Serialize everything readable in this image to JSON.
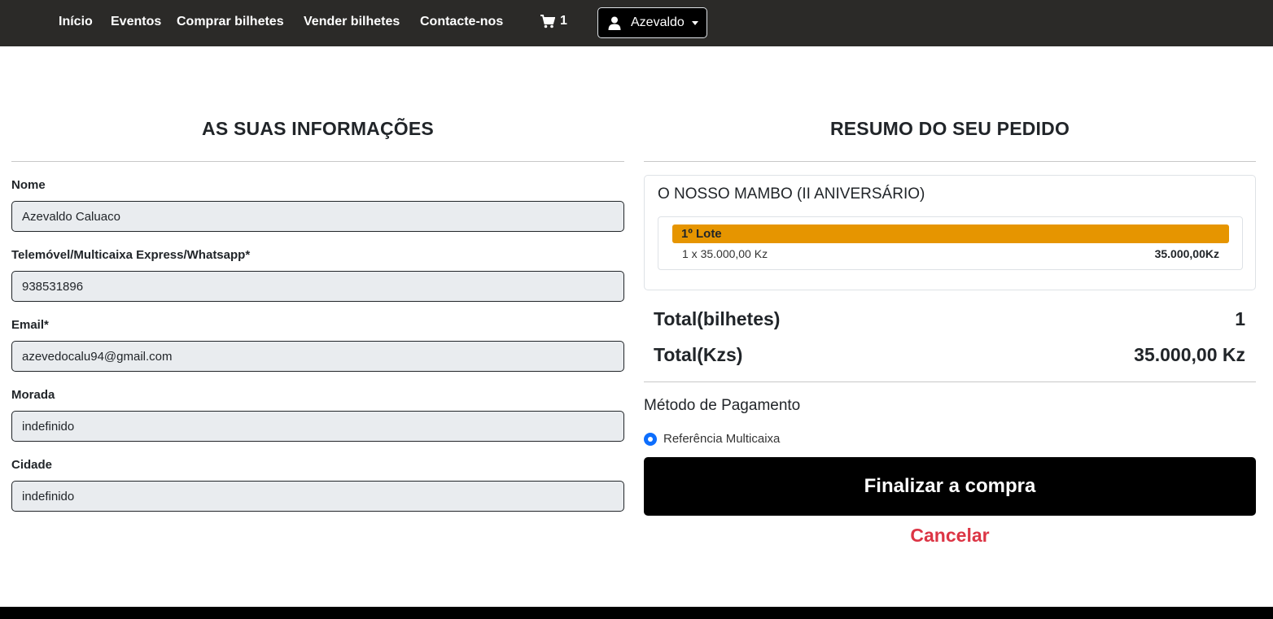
{
  "navbar": {
    "links": [
      "Início",
      "Eventos",
      "Comprar bilhetes",
      "Vender bilhetes",
      "Contacte-nos"
    ],
    "cart_icon": "shopping-cart-icon",
    "cart_count": "1",
    "user_icon": "user-icon",
    "user_name": "Azevaldo"
  },
  "info_section": {
    "title": "AS SUAS INFORMAÇÕES",
    "fields": [
      {
        "label": "Nome",
        "value": "Azevaldo Caluaco"
      },
      {
        "label": "Telemóvel/Multicaixa Express/Whatsapp*",
        "value": "938531896"
      },
      {
        "label": "Email*",
        "value": "azevedocalu94@gmail.com"
      },
      {
        "label": "Morada",
        "value": "indefinido"
      },
      {
        "label": "Cidade",
        "value": "indefinido"
      }
    ]
  },
  "summary_section": {
    "title": "RESUMO DO SEU PEDIDO",
    "event_name": "O NOSSO MAMBO (II ANIVERSÁRIO)",
    "lot": {
      "name": "1º Lote",
      "quantity_line": "1 x 35.000,00 Kz",
      "subtotal": "35.000,00Kz"
    },
    "totals": {
      "tickets_label": "Total(bilhetes)",
      "tickets_value": "1",
      "amount_label": "Total(Kzs)",
      "amount_value": "35.000,00 Kz"
    },
    "payment": {
      "title": "Método de Pagamento",
      "option": "Referência Multicaixa"
    },
    "finalize_label": "Finalizar a compra",
    "cancel_label": "Cancelar"
  },
  "colors": {
    "navbar_bg": "#2b2a28",
    "lot_accent": "#e69500",
    "cancel_red": "#dc3545",
    "radio_blue": "#0d6efd"
  }
}
